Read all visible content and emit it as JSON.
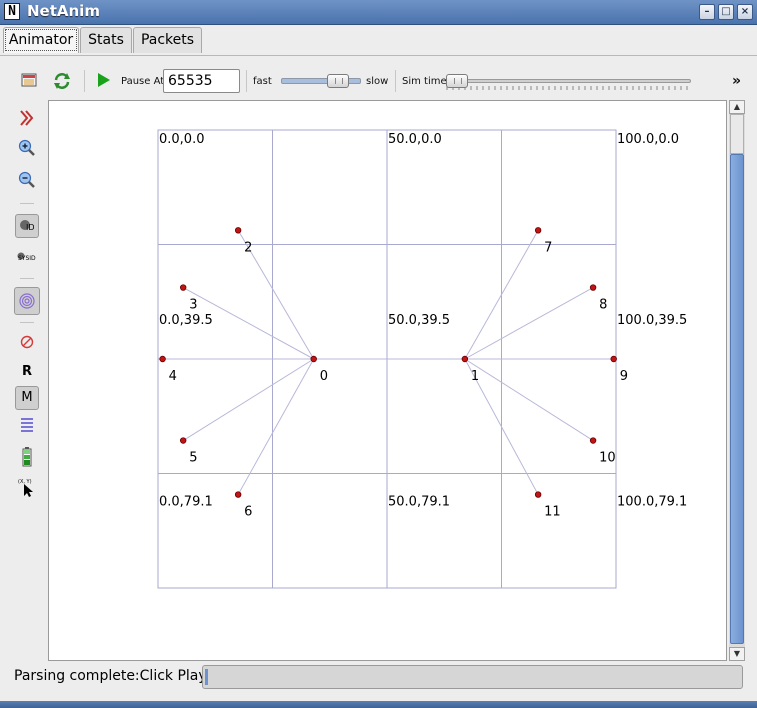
{
  "window": {
    "title": "NetAnim",
    "icon_letter": "N",
    "controls": [
      "minimize",
      "maximize",
      "close"
    ]
  },
  "tabs": [
    {
      "label": "Animator",
      "active": true
    },
    {
      "label": "Stats",
      "active": false
    },
    {
      "label": "Packets",
      "active": false
    }
  ],
  "toolbar": {
    "pause_at_label": "Pause At",
    "pause_at_value": "65535",
    "fast_label": "fast",
    "slow_label": "slow",
    "speed_slider_fraction": 0.82,
    "sim_time_label": "Sim time",
    "sim_time_fraction": 0.0,
    "overflow_label": "»"
  },
  "sidebar": {
    "r_label": "R",
    "m_label": "M",
    "xy_label": "(X, Y)",
    "id_label": "ID",
    "sysid_label": "SYSID"
  },
  "grid": {
    "x_range": [
      0,
      100
    ],
    "y_range": [
      0,
      100
    ],
    "labels": [
      {
        "text": "0.0,0.0",
        "x": 0,
        "y": 0
      },
      {
        "text": "50.0,0.0",
        "x": 50,
        "y": 0
      },
      {
        "text": "100.0,0.0",
        "x": 100,
        "y": 0
      },
      {
        "text": "0.0,39.5",
        "x": 0,
        "y": 39.5
      },
      {
        "text": "50.0,39.5",
        "x": 50,
        "y": 39.5
      },
      {
        "text": "100.0,39.5",
        "x": 100,
        "y": 39.5
      },
      {
        "text": "0.0,79.1",
        "x": 0,
        "y": 79.1
      },
      {
        "text": "50.0,79.1",
        "x": 50,
        "y": 79.1
      },
      {
        "text": "100.0,79.1",
        "x": 100,
        "y": 79.1
      }
    ]
  },
  "nodes": [
    {
      "id": "0",
      "x": 34.0,
      "y": 50.0
    },
    {
      "id": "1",
      "x": 67.0,
      "y": 50.0
    },
    {
      "id": "2",
      "x": 17.5,
      "y": 21.9
    },
    {
      "id": "3",
      "x": 5.5,
      "y": 34.4
    },
    {
      "id": "4",
      "x": 1.0,
      "y": 50.0
    },
    {
      "id": "5",
      "x": 5.5,
      "y": 67.8
    },
    {
      "id": "6",
      "x": 17.5,
      "y": 79.6
    },
    {
      "id": "7",
      "x": 83.0,
      "y": 21.9
    },
    {
      "id": "8",
      "x": 95.0,
      "y": 34.4
    },
    {
      "id": "9",
      "x": 99.5,
      "y": 50.0
    },
    {
      "id": "10",
      "x": 95.0,
      "y": 67.8
    },
    {
      "id": "11",
      "x": 83.0,
      "y": 79.6
    }
  ],
  "links": [
    [
      "0",
      "1"
    ],
    [
      "0",
      "2"
    ],
    [
      "0",
      "3"
    ],
    [
      "0",
      "4"
    ],
    [
      "0",
      "5"
    ],
    [
      "0",
      "6"
    ],
    [
      "1",
      "7"
    ],
    [
      "1",
      "8"
    ],
    [
      "1",
      "9"
    ],
    [
      "1",
      "10"
    ],
    [
      "1",
      "11"
    ],
    [
      "4",
      "9"
    ]
  ],
  "status": {
    "text": "Parsing complete:Click Play",
    "progress_fraction": 0.0
  }
}
